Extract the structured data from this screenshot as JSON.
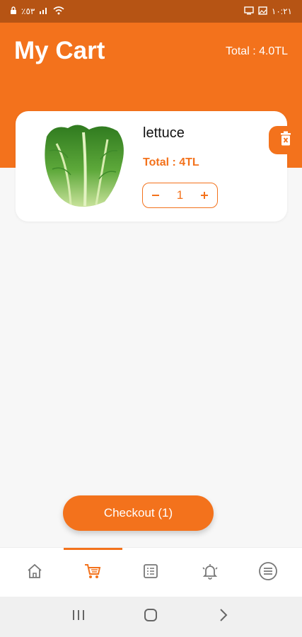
{
  "status_bar": {
    "left_text": "٪٥٣",
    "time": "١٠:٢١"
  },
  "header": {
    "title": "My Cart",
    "total": "Total : 4.0TL"
  },
  "cart": {
    "items": [
      {
        "name": "lettuce",
        "total": "Total : 4TL",
        "quantity": "1"
      }
    ]
  },
  "checkout": {
    "label": "Checkout (1)"
  },
  "bottom_nav": {
    "active": "cart",
    "items": [
      {
        "icon": "home-icon"
      },
      {
        "icon": "cart-icon"
      },
      {
        "icon": "orders-list-icon"
      },
      {
        "icon": "notifications-bell-icon"
      },
      {
        "icon": "menu-icon"
      }
    ]
  },
  "colors": {
    "accent": "#f3721c",
    "status_bar": "#b65414",
    "background": "#f7f7f7"
  }
}
